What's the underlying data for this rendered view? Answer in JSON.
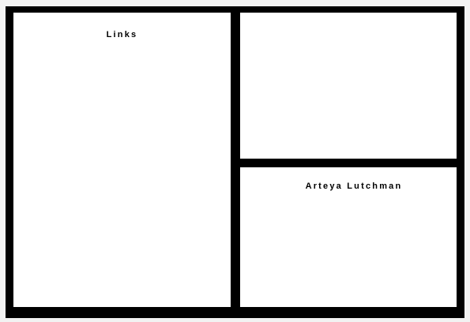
{
  "panels": {
    "left": {
      "title": "Links"
    },
    "top_right": {
      "title": ""
    },
    "bottom_right": {
      "title": "Arteya Lutchman"
    }
  }
}
